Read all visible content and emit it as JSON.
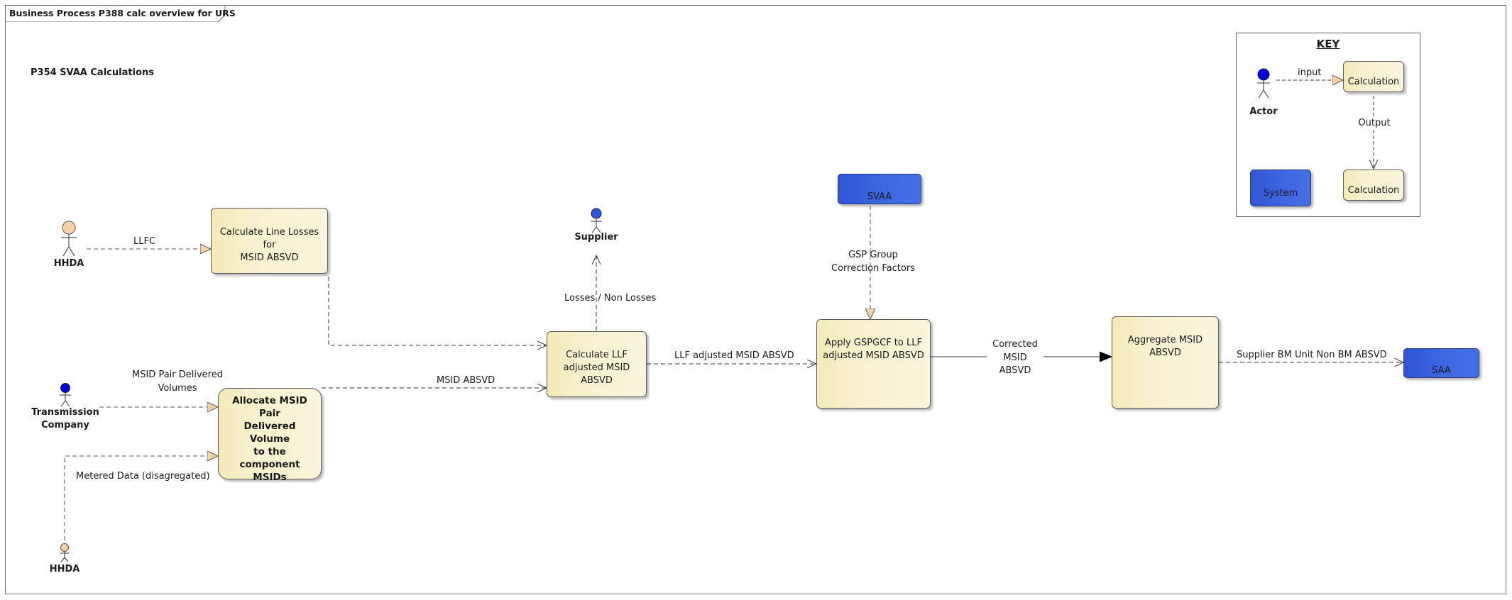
{
  "frame": {
    "title": "Business Process P388 calc overview for URS"
  },
  "section_title": "P354 SVAA Calculations",
  "colors": {
    "calculation_fill": "#f8f1cf",
    "system_fill": "#3d66e0",
    "actor_external_fill": "#f5d3a5",
    "actor_internal_fill": "#0000e0",
    "supplier_actor_fill": "#2f56d6",
    "input_arrowhead": "#f5d3a5"
  },
  "actors": {
    "hhda_top": {
      "label": "HHDA",
      "icon": "actor-icon"
    },
    "transmission_company": {
      "label_line1": "Transmission",
      "label_line2": "Company",
      "icon": "actor-icon"
    },
    "hhda_bottom": {
      "label": "HHDA",
      "icon": "actor-icon"
    },
    "supplier": {
      "label": "Supplier",
      "icon": "actor-icon"
    }
  },
  "calculations": {
    "line_losses": {
      "line1": "Calculate Line Losses for",
      "line2": "MSID ABSVD"
    },
    "allocate": {
      "line1": "Allocate MSID Pair",
      "line2": "Delivered Volume",
      "line3": "to the component",
      "line4": "MSIDs"
    },
    "calc_llf": {
      "line1": "Calculate LLF",
      "line2": "adjusted MSID",
      "line3": "ABSVD"
    },
    "apply_gspgcf": {
      "line1": "Apply GSPGCF to LLF",
      "line2": "adjusted MSID ABSVD"
    },
    "aggregate": {
      "line1": "Aggregate MSID",
      "line2": "ABSVD"
    }
  },
  "systems": {
    "svaa": {
      "label": "SVAA"
    },
    "saa": {
      "label": "SAA"
    }
  },
  "flows": {
    "llfc": "LLFC",
    "msid_pair_delivered_line1": "MSID Pair Delivered",
    "msid_pair_delivered_line2": "Volumes",
    "metered_data": "Metered Data (disagregated)",
    "msid_absvd": "MSID ABSVD",
    "losses_non_losses": "Losses / Non Losses",
    "gsp_group_line1": "GSP Group",
    "gsp_group_line2": "Correction Factors",
    "llf_adjusted": "LLF adjusted MSID ABSVD",
    "corrected_line1": "Corrected",
    "corrected_line2": "MSID",
    "corrected_line3": "ABSVD",
    "supplier_bm_unit": "Supplier BM Unit Non BM ABSVD"
  },
  "key": {
    "title": "KEY",
    "actor_label": "Actor",
    "input_label": "input",
    "output_label": "Output",
    "calculation_label_1": "Calculation",
    "calculation_label_2": "Calculation",
    "system_label": "System"
  }
}
